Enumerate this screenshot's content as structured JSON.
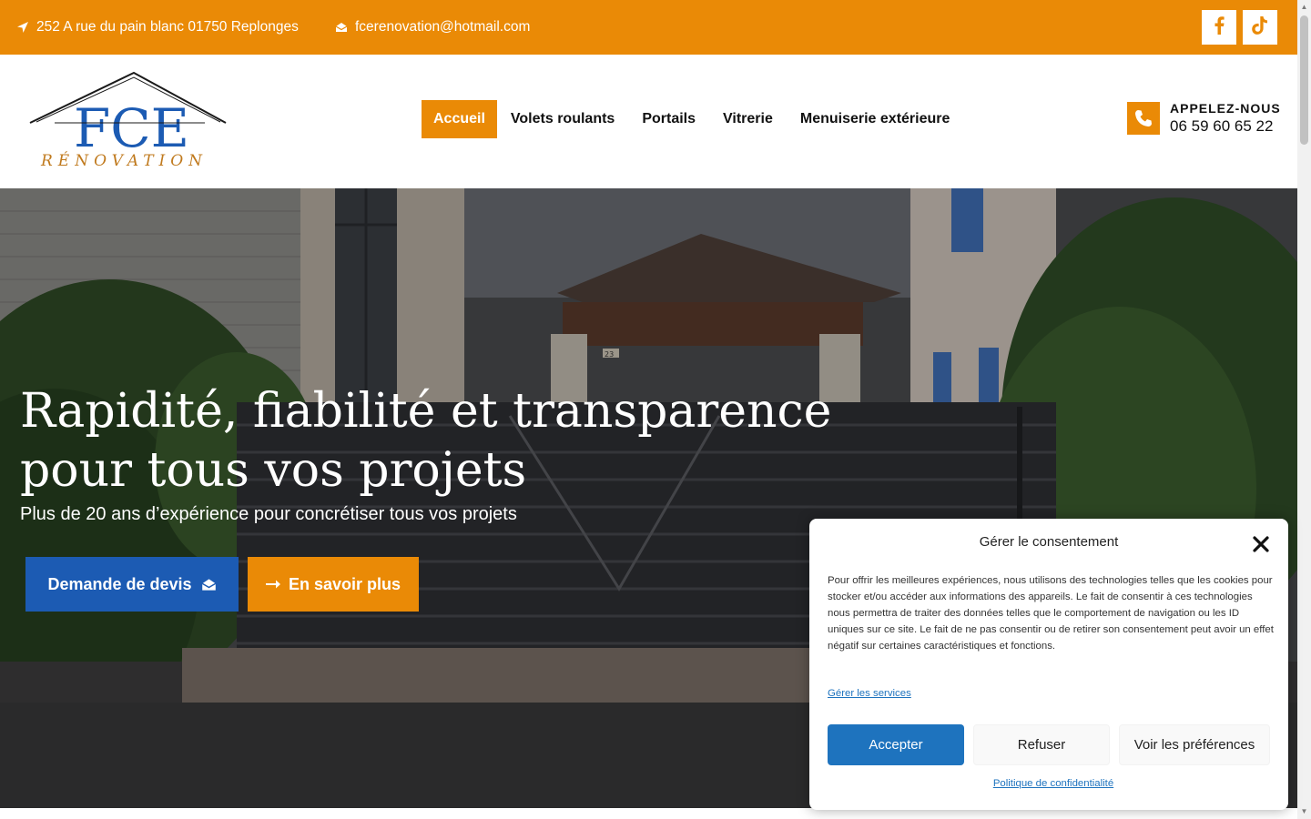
{
  "colors": {
    "accent": "#ea8a06",
    "primary_blue": "#1c5bb3",
    "consent_blue": "#1e73be"
  },
  "topbar": {
    "address": "252 A rue du pain blanc 01750 Replonges",
    "address_icon": "location-arrow-icon",
    "email": "fcerenovation@hotmail.com",
    "email_icon": "envelope-open-icon",
    "social": [
      {
        "icon": "facebook-icon"
      },
      {
        "icon": "tiktok-icon"
      }
    ]
  },
  "header": {
    "logo": {
      "mark": "FCE",
      "subtitle": "RÉNOVATION"
    },
    "nav": [
      {
        "label": "Accueil",
        "active": true
      },
      {
        "label": "Volets roulants",
        "active": false
      },
      {
        "label": "Portails",
        "active": false
      },
      {
        "label": "Vitrerie",
        "active": false
      },
      {
        "label": "Menuiserie extérieure",
        "active": false
      }
    ],
    "call": {
      "title": "APPELEZ-NOUS",
      "number": "06 59 60 65 22",
      "icon": "phone-icon"
    }
  },
  "hero": {
    "title_line1": "Rapidité, fiabilité et transparence",
    "title_line2": "pour tous vos projets",
    "subtitle": "Plus de 20 ans d’expérience pour concrétiser tous vos projets",
    "btn_devis": "Demande de devis",
    "btn_devis_icon": "envelope-open-icon",
    "btn_more": "En savoir plus",
    "btn_more_icon": "arrow-right-icon",
    "house_number": "23"
  },
  "consent": {
    "title": "Gérer le consentement",
    "text": "Pour offrir les meilleures expériences, nous utilisons des technologies telles que les cookies pour stocker et/ou accéder aux informations des appareils. Le fait de consentir à ces technologies nous permettra de traiter des données telles que le comportement de navigation ou les ID uniques sur ce site. Le fait de ne pas consentir ou de retirer son consentement peut avoir un effet négatif sur certaines caractéristiques et fonctions.",
    "manage_link": "Gérer les services",
    "accept": "Accepter",
    "refuse": "Refuser",
    "preferences": "Voir les préférences",
    "policy_link": "Politique de confidentialité"
  }
}
